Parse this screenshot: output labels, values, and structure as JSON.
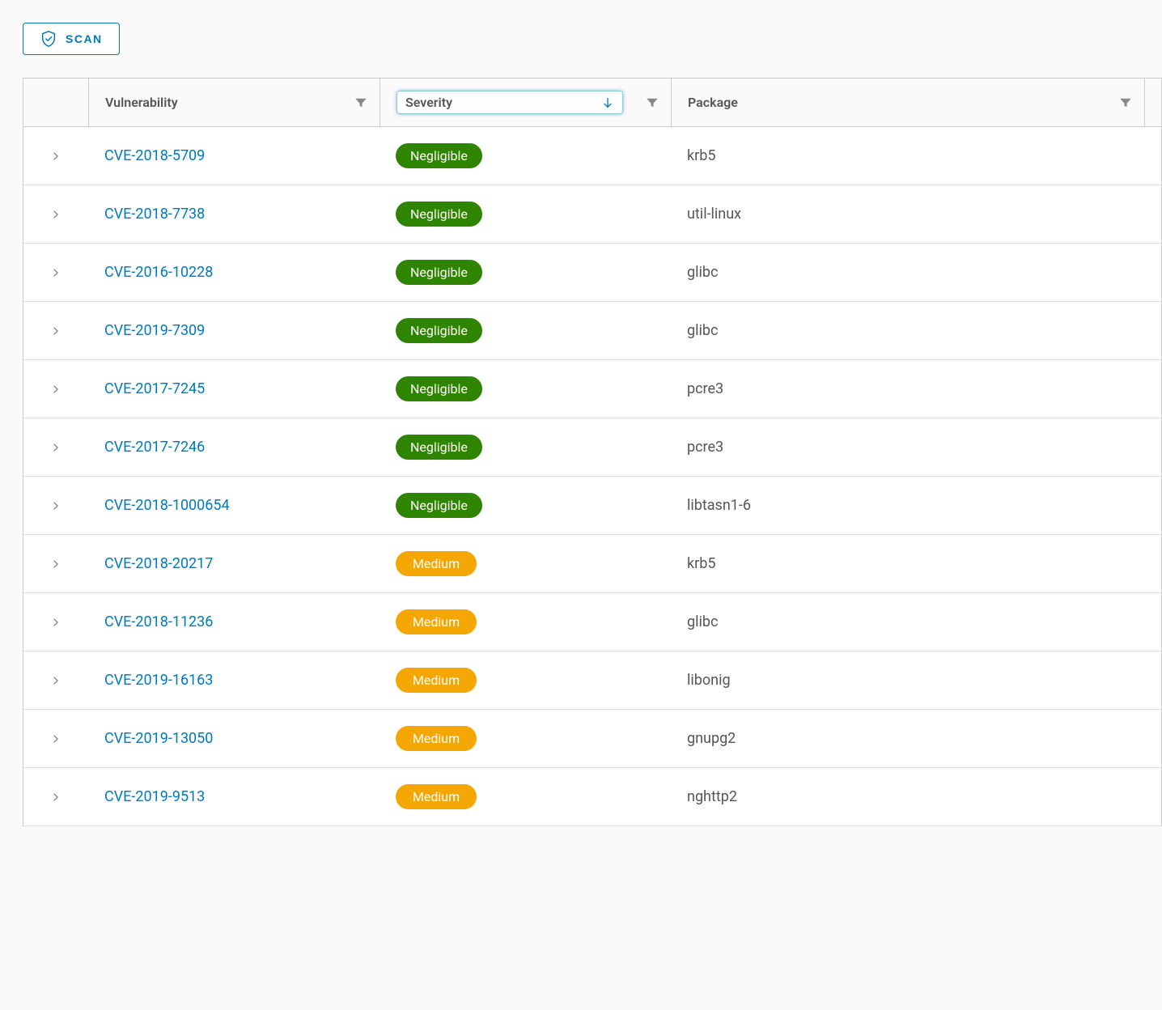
{
  "scan_button_label": "SCAN",
  "columns": {
    "vulnerability": "Vulnerability",
    "severity": "Severity",
    "package": "Package"
  },
  "severity_levels": {
    "negligible": "Negligible",
    "medium": "Medium"
  },
  "rows": [
    {
      "cve": "CVE-2018-5709",
      "severity": "negligible",
      "package": "krb5"
    },
    {
      "cve": "CVE-2018-7738",
      "severity": "negligible",
      "package": "util-linux"
    },
    {
      "cve": "CVE-2016-10228",
      "severity": "negligible",
      "package": "glibc"
    },
    {
      "cve": "CVE-2019-7309",
      "severity": "negligible",
      "package": "glibc"
    },
    {
      "cve": "CVE-2017-7245",
      "severity": "negligible",
      "package": "pcre3"
    },
    {
      "cve": "CVE-2017-7246",
      "severity": "negligible",
      "package": "pcre3"
    },
    {
      "cve": "CVE-2018-1000654",
      "severity": "negligible",
      "package": "libtasn1-6"
    },
    {
      "cve": "CVE-2018-20217",
      "severity": "medium",
      "package": "krb5"
    },
    {
      "cve": "CVE-2018-11236",
      "severity": "medium",
      "package": "glibc"
    },
    {
      "cve": "CVE-2019-16163",
      "severity": "medium",
      "package": "libonig"
    },
    {
      "cve": "CVE-2019-13050",
      "severity": "medium",
      "package": "gnupg2"
    },
    {
      "cve": "CVE-2019-9513",
      "severity": "medium",
      "package": "nghttp2"
    }
  ]
}
